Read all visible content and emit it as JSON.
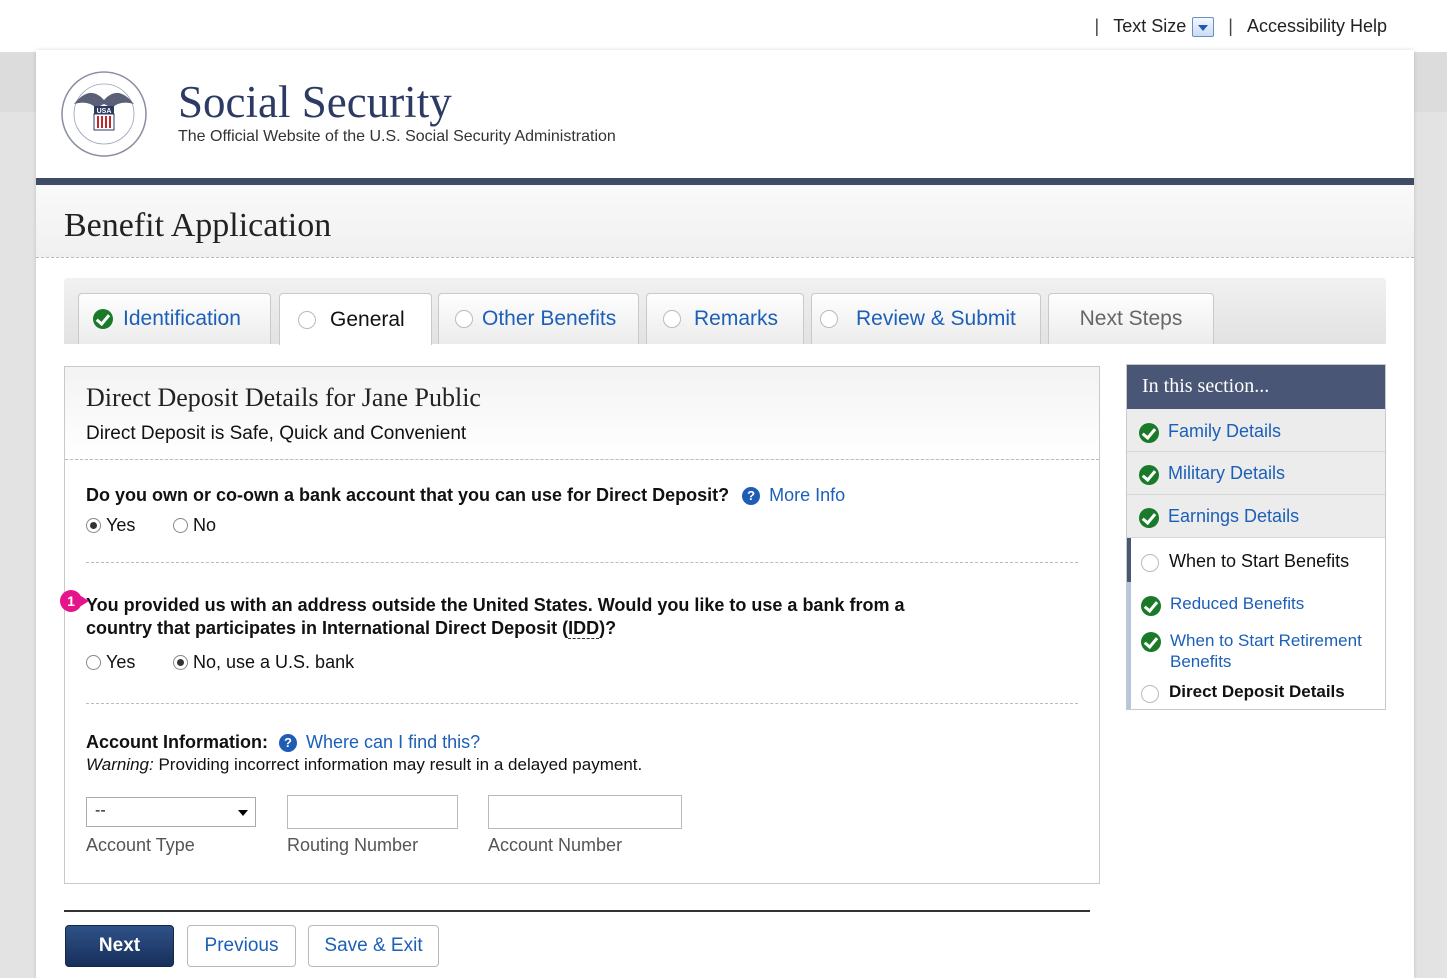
{
  "utility": {
    "text_size_label": "Text Size",
    "accessibility_help": "Accessibility Help"
  },
  "brand": {
    "title": "Social Security",
    "subtitle": "The Official Website of the U.S. Social Security Administration"
  },
  "app": {
    "title": "Benefit Application"
  },
  "tabs": [
    {
      "label": "Identification",
      "status": "complete"
    },
    {
      "label": "General",
      "status": "active"
    },
    {
      "label": "Other Benefits",
      "status": "pending"
    },
    {
      "label": "Remarks",
      "status": "pending"
    },
    {
      "label": "Review & Submit",
      "status": "pending"
    },
    {
      "label": "Next Steps",
      "status": "disabled"
    }
  ],
  "panel": {
    "title": "Direct Deposit Details for Jane Public",
    "subtitle": "Direct Deposit is Safe, Quick and Convenient",
    "q1": {
      "text": "Do you own or co-own a bank account that you can use for Direct Deposit?",
      "help_link": "More Info",
      "options": [
        "Yes",
        "No"
      ],
      "selected": "Yes"
    },
    "q2": {
      "marker": "1",
      "line1": "You provided us with an address outside the United States. Would you like to use a bank from a",
      "line2_prefix": "country that participates in International Direct Deposit (",
      "abbr": "IDD",
      "line2_suffix": ")?",
      "options": [
        "Yes",
        "No, use a U.S. bank"
      ],
      "selected": "No, use a U.S. bank"
    },
    "account": {
      "label": "Account Information:",
      "help_link": "Where can I find this?",
      "warning_em": "Warning:",
      "warning_text": " Providing incorrect information may result in a delayed payment.",
      "account_type_value": "--",
      "account_type_label": "Account Type",
      "routing_label": "Routing Number",
      "account_number_label": "Account Number"
    }
  },
  "buttons": {
    "next": "Next",
    "previous": "Previous",
    "save_exit": "Save & Exit"
  },
  "sidebar": {
    "heading": "In this section...",
    "items": [
      {
        "label": "Family Details",
        "status": "complete"
      },
      {
        "label": "Military Details",
        "status": "complete"
      },
      {
        "label": "Earnings Details",
        "status": "complete"
      },
      {
        "label": "When to Start Benefits",
        "status": "current-parent"
      },
      {
        "label": "Reduced Benefits",
        "status": "complete"
      },
      {
        "label": "When to Start Retirement Benefits",
        "status": "complete"
      },
      {
        "label": "Direct Deposit Details",
        "status": "current"
      }
    ]
  },
  "colors": {
    "brand_navy": "#2c3a64",
    "header_rule": "#404b66",
    "link_blue": "#1c5fb8",
    "check_green": "#1a7a2a",
    "marker_pink": "#e6148a",
    "side_head": "#495675"
  }
}
